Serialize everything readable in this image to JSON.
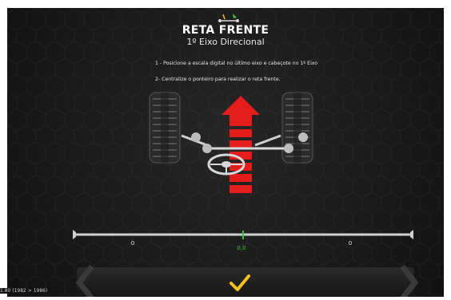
{
  "header": {
    "title": "RETA FRENTE",
    "subtitle": "1º Eixo Direcional",
    "logo_icon": "alignment-logo-icon"
  },
  "instructions": {
    "step1": "1 - Posicione a escala digital no último eixo e cabeçote no 1º Eixo",
    "step2": "2- Centralize o ponteiro para realizar o reta frente."
  },
  "diagram": {
    "icons": [
      "tire-left-icon",
      "tire-right-icon",
      "axle-icon",
      "steering-wheel-icon",
      "forward-arrow-icon"
    ],
    "arrow_color": "#e51c1c"
  },
  "scale": {
    "left_value": "0",
    "center_value": "0,0",
    "right_value": "0",
    "center_color": "#3cc43c",
    "pointer_fraction": 0.5
  },
  "actions": {
    "confirm_icon": "checkmark-icon",
    "confirm_color": "#f0c419"
  },
  "footer": {
    "version": "1.80 (1982 > 1986)"
  }
}
